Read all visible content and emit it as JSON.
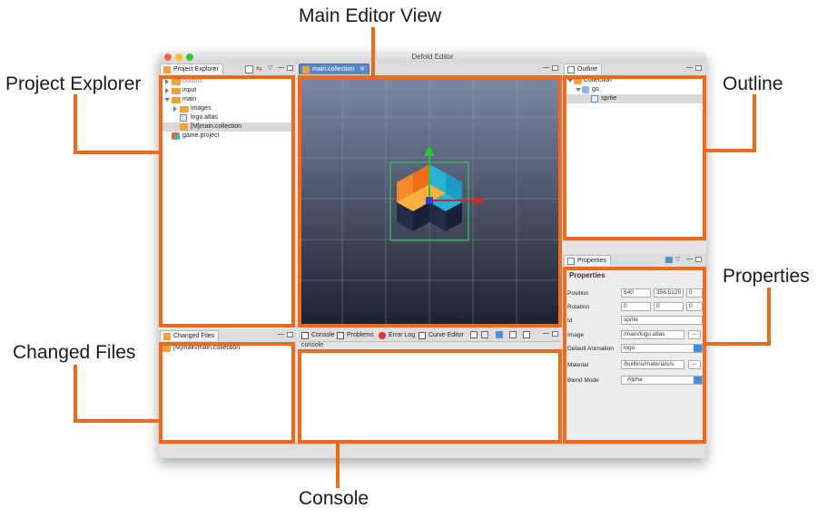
{
  "annotations": {
    "main_editor_view": "Main Editor View",
    "project_explorer": "Project Explorer",
    "outline": "Outline",
    "properties": "Properties",
    "changed_files": "Changed Files",
    "console": "Console"
  },
  "window": {
    "title": "Defold Editor"
  },
  "project_explorer": {
    "tab_label": "Project Explorer",
    "items": [
      {
        "label": "builtins",
        "depth": 0,
        "expanded": false,
        "kind": "folder"
      },
      {
        "label": "input",
        "depth": 0,
        "expanded": false,
        "kind": "folder"
      },
      {
        "label": "main",
        "depth": 0,
        "expanded": true,
        "kind": "folder"
      },
      {
        "label": "images",
        "depth": 1,
        "expanded": false,
        "kind": "folder"
      },
      {
        "label": "logo.atlas",
        "depth": 1,
        "kind": "atlas"
      },
      {
        "label": "[M]main.collection",
        "depth": 1,
        "kind": "collection",
        "selected": true
      },
      {
        "label": "game.project",
        "depth": 0,
        "kind": "project"
      }
    ]
  },
  "editor": {
    "tab_label": "main.collection"
  },
  "outline": {
    "tab_label": "Outline",
    "items": [
      {
        "label": "Collection",
        "depth": 0
      },
      {
        "label": "go",
        "depth": 1
      },
      {
        "label": "sprite",
        "depth": 2,
        "selected": true
      }
    ]
  },
  "properties": {
    "tab_label": "Properties",
    "heading": "Properties",
    "position": [
      "640",
      "356.5129",
      "0"
    ],
    "rotation": [
      "0",
      "0",
      "0"
    ],
    "id": "sprite",
    "image": "/main/logo.atlas",
    "default_animation": "logo",
    "material": "/builtins/materials/s",
    "blend_mode": "Alpha",
    "labels": {
      "position": "Position",
      "rotation": "Rotation",
      "id": "Id",
      "image": "Image",
      "default_animation": "Default Animation",
      "material": "Material",
      "blend_mode": "Blend Mode"
    },
    "browse_label": "..."
  },
  "changed_files": {
    "tab_label": "Changed Files",
    "items": [
      "[M]main/main.collection"
    ]
  },
  "bottom_tabs": {
    "console": "Console",
    "problems": "Problems",
    "error_log": "Error Log",
    "curve_editor": "Curve Editor",
    "panel_title": "console"
  },
  "colors": {
    "annotation_orange": "#f06a1a",
    "viewport_top": "#7b8aa6",
    "viewport_bottom": "#1e2330",
    "gizmo_y": "#2ec43a",
    "gizmo_x": "#e02020",
    "gizmo_z": "#2244ee"
  }
}
